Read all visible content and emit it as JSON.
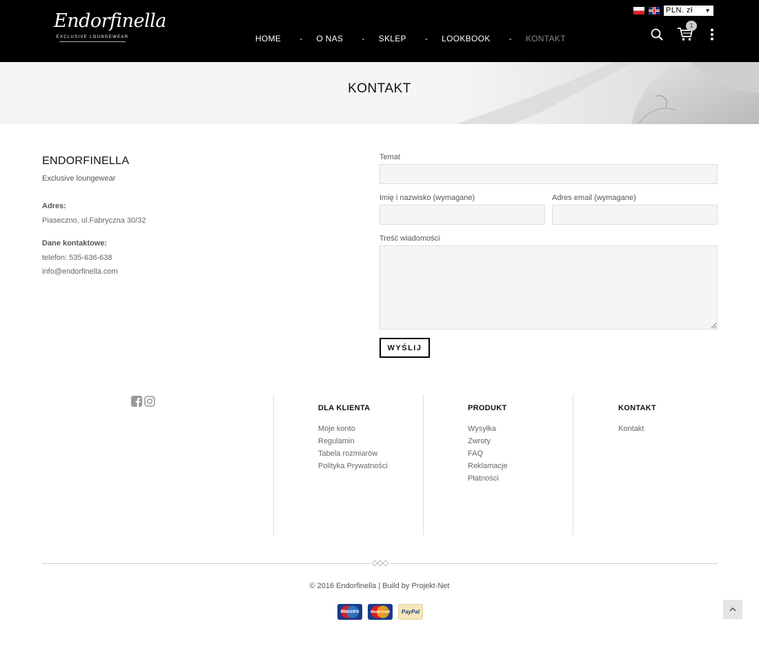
{
  "brand": {
    "logo_script": "Endorfinella",
    "logo_subtitle": "EXCLUSIVE LOUNGEWEAR"
  },
  "nav": {
    "items": [
      {
        "label": "HOME",
        "active": false
      },
      {
        "label": "O NAS",
        "active": false
      },
      {
        "label": "SKLEP",
        "active": false
      },
      {
        "label": "LOOKBOOK",
        "active": false
      },
      {
        "label": "KONTAKT",
        "active": true
      }
    ],
    "separator": "-"
  },
  "header": {
    "currency": "PLN. zł",
    "currency_arrow": "▼",
    "cart_count": "1",
    "icons": [
      "flag-pl-icon",
      "flag-en-icon",
      "search-icon",
      "cart-icon",
      "more-vertical-icon"
    ]
  },
  "banner": {
    "title": "KONTAKT"
  },
  "contact": {
    "company": "ENDORFINELLA",
    "tagline": "Exclusive loungewear",
    "address_label": "Adres:",
    "address": "Piaseczno, ul.Fabryczna 30/32",
    "contact_label": "Dane kontaktowe:",
    "phone": "telefon: 535-636-638",
    "email": "info@endorfinella.com"
  },
  "form": {
    "subject_label": "Temat",
    "subject_value": "",
    "name_label": "Imię i nazwisko (wymagane)",
    "name_value": "",
    "email_label": "Adres email (wymagane)",
    "email_value": "",
    "message_label": "Treść wiadomości",
    "message_value": "",
    "submit_label": "WYŚLIJ"
  },
  "footer": {
    "social_icons": [
      "facebook-icon",
      "instagram-icon"
    ],
    "columns": [
      {
        "title": "DLA KLIENTA",
        "links": [
          "Moje konto",
          "Regulamin",
          "Tabela rozmiarów",
          "Polityka Prywatności"
        ]
      },
      {
        "title": "PRODUKT",
        "links": [
          "Wysyłka",
          "Zwroty",
          "FAQ",
          "Reklamacje",
          "Płatności"
        ]
      },
      {
        "title": "KONTAKT",
        "links": [
          "Kontakt"
        ]
      }
    ],
    "copyright": "© 2016 Endorfinella | Build by Projekt-Net",
    "payments": [
      "Maestro",
      "MasterCard",
      "PayPal"
    ]
  },
  "colors": {
    "header_bg": "#000000",
    "banner_bg": "#f5f5f5",
    "input_bg": "#f5f5f5",
    "nav_active": "#888888"
  }
}
